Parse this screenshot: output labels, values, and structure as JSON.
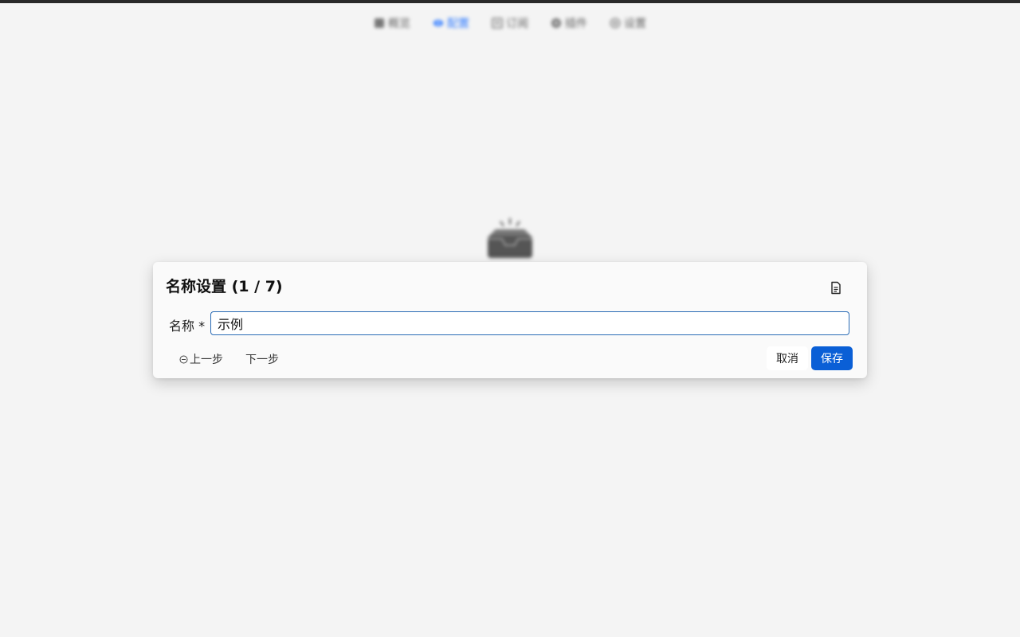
{
  "nav": {
    "items": [
      {
        "label": "概览",
        "icon": "dashboard-icon",
        "active": false
      },
      {
        "label": "配置",
        "icon": "config-icon",
        "active": true
      },
      {
        "label": "订阅",
        "icon": "subscription-icon",
        "active": false
      },
      {
        "label": "插件",
        "icon": "plugin-icon",
        "active": false
      },
      {
        "label": "设置",
        "icon": "settings-icon",
        "active": false
      }
    ],
    "active_color": "#2f7bff"
  },
  "empty_state": {
    "icon": "empty-inbox-icon"
  },
  "dialog": {
    "title": "名称设置 (1 / 7)",
    "doc_icon": "document-icon",
    "field_label": "名称 *",
    "field_value": "示例",
    "prev_label": "上一步",
    "next_label": "下一步",
    "cancel_label": "取消",
    "save_label": "保存",
    "accent_color": "#0a5fd6"
  }
}
